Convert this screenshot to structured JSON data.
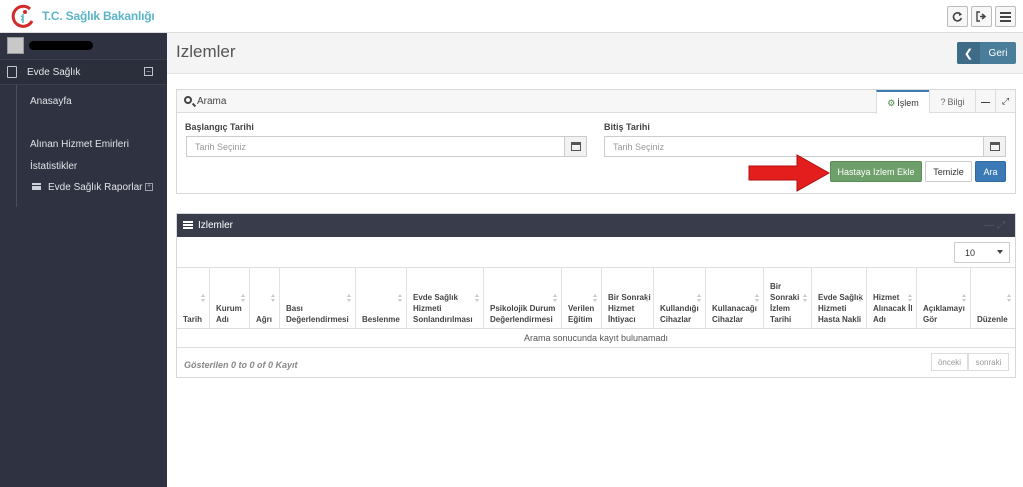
{
  "header": {
    "logo_text": "T.C. Sağlık Bakanlığı",
    "buttons": [
      {
        "icon": "refresh-icon"
      },
      {
        "icon": "sign-out-icon"
      },
      {
        "icon": "menu-icon"
      }
    ]
  },
  "sidebar": {
    "section_label": "Evde Sağlık",
    "items": [
      {
        "label": "Anasayfa"
      },
      {
        "label": "Alınan Hizmet Emirleri"
      },
      {
        "label": "İstatistikler"
      },
      {
        "label": "Evde Sağlık Raporlar"
      }
    ]
  },
  "page": {
    "title": "Izlemler",
    "back_label": "Geri"
  },
  "search": {
    "title": "Arama",
    "tabs": [
      "İşlem",
      "Bilgi"
    ],
    "start_label": "Başlangıç Tarihi",
    "start_placeholder": "Tarih Seçiniz",
    "end_label": "Bitiş Tarihi",
    "end_placeholder": "Tarih Seçiniz",
    "add_label": "Hastaya Izlem Ekle",
    "clear_label": "Temizle",
    "search_label": "Ara"
  },
  "grid": {
    "title": "Izlemler",
    "page_size": "10",
    "columns": [
      "Tarih",
      "Kurum Adı",
      "Ağrı",
      "Bası Değerlendirmesi",
      "Beslenme",
      "Evde Sağlık Hizmeti Sonlandırılması",
      "Psikolojik Durum Değerlendirmesi",
      "Verilen Eğitim",
      "Bir Sonraki Hizmet İhtiyacı",
      "Kullandığı Cihazlar",
      "Kullanacağı Cihazlar",
      "Bir Sonraki İzlem Tarihi",
      "Evde Sağlık Hizmeti Hasta Nakli",
      "Hizmet Alınacak İl Adı",
      "Açıklamayı Gör",
      "Düzenle"
    ],
    "empty_text": "Arama sonucunda kayıt bulunamadı",
    "info_text": "Gösterilen 0 to 0 of 0 Kayıt",
    "prev_label": "önceki",
    "next_label": "sonraki"
  },
  "colors": {
    "sidebar_bg": "#2f3341",
    "grid_header_bg": "#383c4b",
    "back_button": "#4a7d99",
    "add_button": "#6ea06c",
    "search_button": "#3b7ab6",
    "logo_text": "#5bb5c8",
    "callout_arrow": "#e41d1d"
  }
}
